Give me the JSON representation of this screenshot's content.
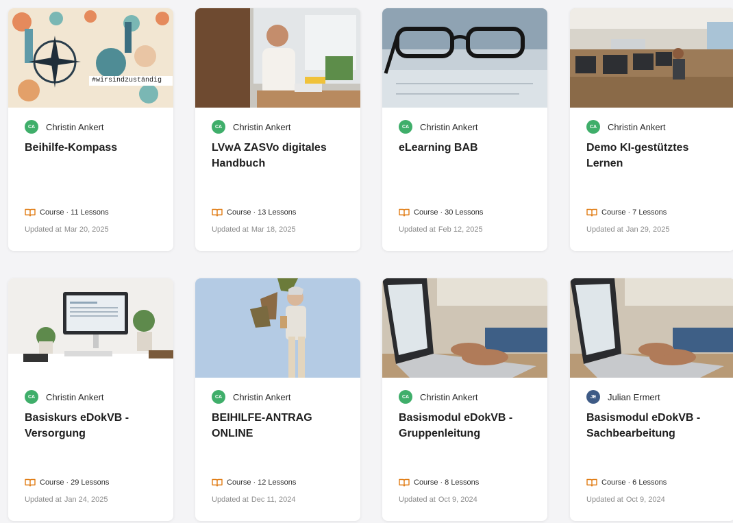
{
  "colors": {
    "accent": "#e07b12",
    "avatar_ca": "#3fae6a",
    "avatar_je": "#3e5b86"
  },
  "courses": [
    {
      "author": "Christin Ankert",
      "initials": "CA",
      "title": "Beihilfe-Kompass",
      "type": "Course",
      "lessons": "11 Lessons",
      "updated_label": "Updated at",
      "updated": "Mar 20, 2025",
      "image": {
        "hashtag": "#wirsindzuständig"
      }
    },
    {
      "author": "Christin Ankert",
      "initials": "CA",
      "title": "LVwA ZASVo digitales Handbuch",
      "type": "Course",
      "lessons": "13 Lessons",
      "updated_label": "Updated at",
      "updated": "Mar 18, 2025"
    },
    {
      "author": "Christin Ankert",
      "initials": "CA",
      "title": "eLearning BAB",
      "type": "Course",
      "lessons": "30 Lessons",
      "updated_label": "Updated at",
      "updated": "Feb 12, 2025"
    },
    {
      "author": "Christin Ankert",
      "initials": "CA",
      "title": "Demo KI-gestütztes Lernen",
      "type": "Course",
      "lessons": "7 Lessons",
      "updated_label": "Updated at",
      "updated": "Jan 29, 2025"
    },
    {
      "author": "Christin Ankert",
      "initials": "CA",
      "title": "Basiskurs eDokVB - Versorgung",
      "type": "Course",
      "lessons": "29 Lessons",
      "updated_label": "Updated at",
      "updated": "Jan 24, 2025"
    },
    {
      "author": "Christin Ankert",
      "initials": "CA",
      "title": "BEIHILFE-ANTRAG ONLINE",
      "type": "Course",
      "lessons": "12 Lessons",
      "updated_label": "Updated at",
      "updated": "Dec 11, 2024"
    },
    {
      "author": "Christin Ankert",
      "initials": "CA",
      "title": "Basismodul eDokVB - Gruppenleitung",
      "type": "Course",
      "lessons": "8 Lessons",
      "updated_label": "Updated at",
      "updated": "Oct 9, 2024"
    },
    {
      "author": "Julian Ermert",
      "initials": "JE",
      "title": "Basismodul eDokVB - Sachbearbeitung",
      "type": "Course",
      "lessons": "6 Lessons",
      "updated_label": "Updated at",
      "updated": "Oct 9, 2024"
    }
  ]
}
